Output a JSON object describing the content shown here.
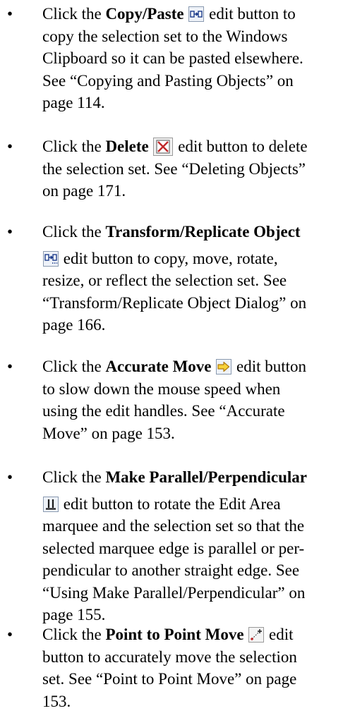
{
  "items": [
    {
      "lead": "Click the ",
      "name": "Copy/Paste",
      "rest": " edit button to copy the selection set to the Windows Clipboard so it can be pasted elsewhere. See “Copying and Pasting Objects” on page 114.",
      "icon": "copy-paste-icon"
    },
    {
      "lead": "Click the ",
      "name": "Delete",
      "rest": " edit button to delete the selection set. See “Deleting Objects” on page 171.",
      "icon": "delete-icon"
    },
    {
      "lead": "Click the ",
      "name": "Transform/Replicate Object",
      "rest": " edit button to copy, move, rotate, resize, or reflect the selection set. See “Transform/Replicate Object Dialog” on page 166.",
      "icon": "transform-replicate-icon"
    },
    {
      "lead": "Click the ",
      "name": "Accurate Move",
      "rest": " edit button to slow down the mouse speed when using the edit handles. See “Accurate Move” on page 153.",
      "icon": "accurate-move-icon"
    },
    {
      "lead": "Click the ",
      "name": "Make Parallel/Perpendicular",
      "rest": " edit button to rotate the Edit Area marquee and the selection set so that the selected marquee edge is parallel or perpendicular to another straight edge. See “Using Make Parallel/Perpendicular” on page 155.",
      "icon": "make-parallel-perpendicular-icon"
    },
    {
      "lead": "Click the ",
      "name": "Point to Point Move",
      "rest": " edit button to accurately move the selection set. See “Point to Point Move” on page 153.",
      "icon": "point-to-point-move-icon"
    }
  ],
  "lines": {
    "i0": [
      "copy the selection set to the Windows",
      "Clipboard so it can be pasted elsewhere.",
      "See “Copying and Pasting Objects” on",
      "page 114."
    ],
    "i0_first": " edit button to",
    "i1_first": " edit button to delete",
    "i1": [
      "the selection set. See “Deleting Objects”",
      "on page 171."
    ],
    "i2_second": " edit button to copy, move, rotate,",
    "i2": [
      "resize, or reflect the selection set. See",
      "“Transform/Replicate Object Dialog” on",
      "page 166."
    ],
    "i3_first": " edit button",
    "i3": [
      "to slow down the mouse speed when",
      "using the edit handles. See “Accurate",
      "Move” on page 153."
    ],
    "i4_second": " edit button to rotate the Edit Area",
    "i4": [
      "marquee and the selection set so that the",
      "selected marquee edge is parallel or per-",
      "pendicular to another straight edge. See",
      "“Using Make Parallel/Perpendicular” on",
      "page 155."
    ],
    "i5_first": " edit",
    "i5": [
      "button to accurately move the selection",
      "set. See “Point to Point Move” on page",
      "153."
    ]
  },
  "bullet_char": "•"
}
